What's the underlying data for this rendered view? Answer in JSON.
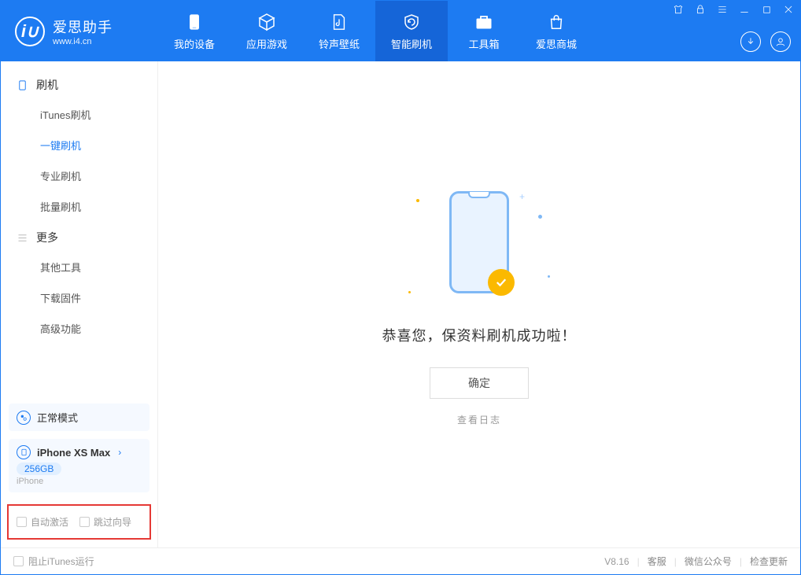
{
  "app": {
    "name": "爱思助手",
    "url": "www.i4.cn"
  },
  "tabs": [
    {
      "label": "我的设备"
    },
    {
      "label": "应用游戏"
    },
    {
      "label": "铃声壁纸"
    },
    {
      "label": "智能刷机"
    },
    {
      "label": "工具箱"
    },
    {
      "label": "爱思商城"
    }
  ],
  "sidebar": {
    "section1_title": "刷机",
    "section1_items": [
      {
        "label": "iTunes刷机"
      },
      {
        "label": "一键刷机",
        "active": true
      },
      {
        "label": "专业刷机"
      },
      {
        "label": "批量刷机"
      }
    ],
    "section2_title": "更多",
    "section2_items": [
      {
        "label": "其他工具"
      },
      {
        "label": "下载固件"
      },
      {
        "label": "高级功能"
      }
    ]
  },
  "mode_card": {
    "label": "正常模式"
  },
  "device_card": {
    "name": "iPhone XS Max",
    "capacity": "256GB",
    "type": "iPhone"
  },
  "checkboxes": {
    "auto_activate": "自动激活",
    "skip_guide": "跳过向导"
  },
  "main": {
    "success": "恭喜您，保资料刷机成功啦！",
    "ok": "确定",
    "view_log": "查看日志"
  },
  "footer": {
    "block_itunes": "阻止iTunes运行",
    "version": "V8.16",
    "support": "客服",
    "wechat": "微信公众号",
    "update": "检查更新"
  }
}
